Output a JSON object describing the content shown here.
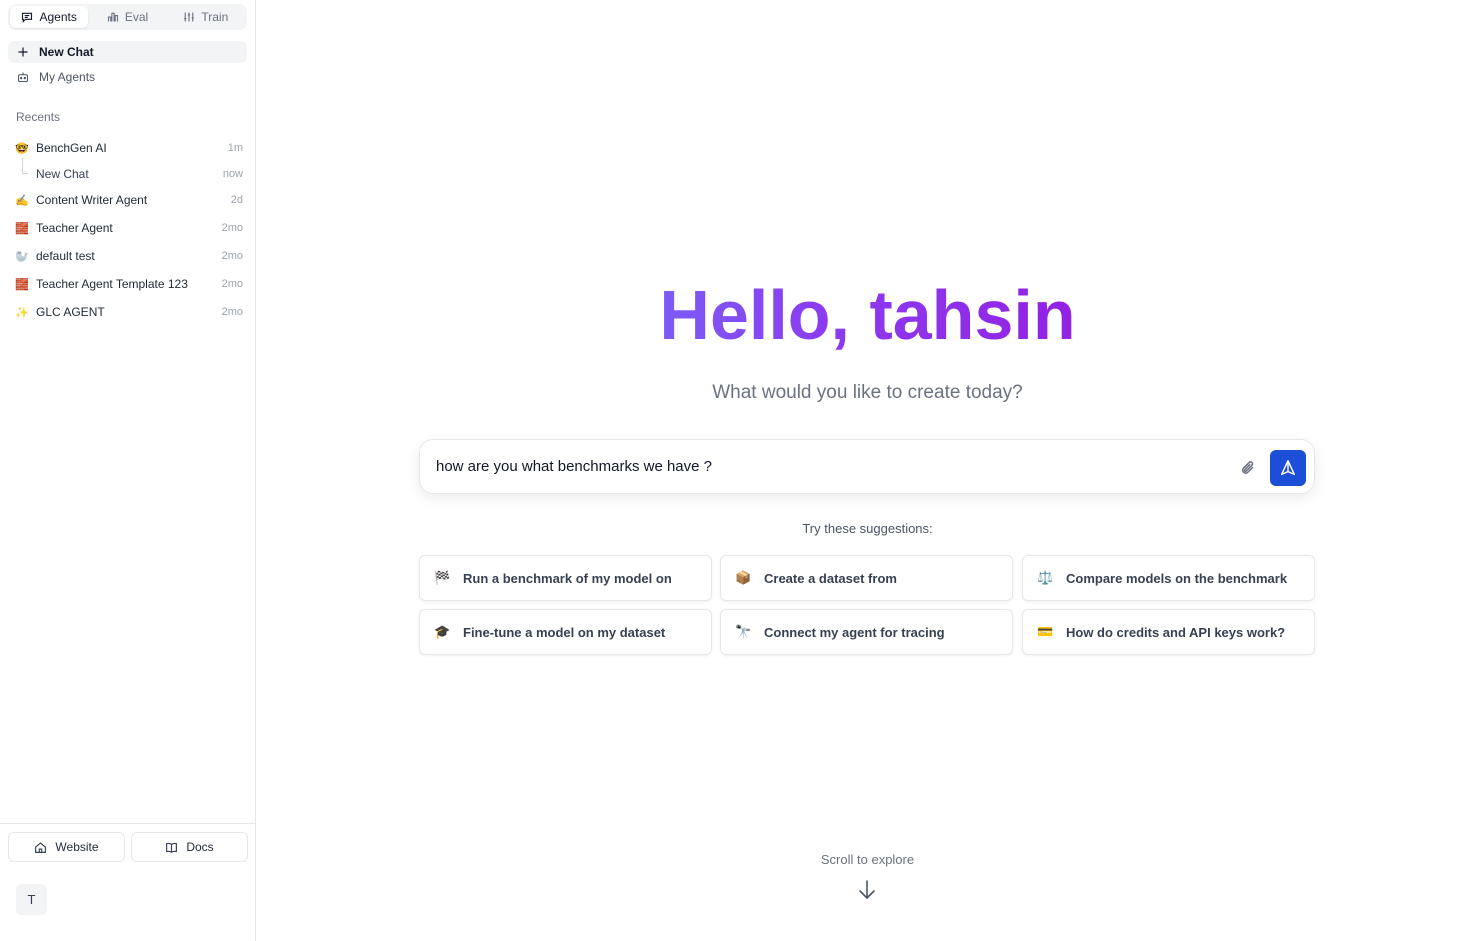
{
  "tabs": [
    {
      "label": "Agents",
      "icon": "chat-icon",
      "active": true
    },
    {
      "label": "Eval",
      "icon": "chart-icon",
      "active": false
    },
    {
      "label": "Train",
      "icon": "sliders-icon",
      "active": false
    }
  ],
  "nav": {
    "new_chat": "New Chat",
    "my_agents": "My Agents"
  },
  "recents": {
    "title": "Recents",
    "items": [
      {
        "emoji": "🤓",
        "label": "BenchGen AI",
        "time": "1m"
      },
      {
        "emoji": "",
        "label": "New Chat",
        "time": "now"
      },
      {
        "emoji": "✍️",
        "label": "Content Writer Agent",
        "time": "2d"
      },
      {
        "emoji": "🧱",
        "label": "Teacher Agent",
        "time": "2mo"
      },
      {
        "emoji": "🦭",
        "label": "default test",
        "time": "2mo"
      },
      {
        "emoji": "🧱",
        "label": "Teacher Agent Template 123",
        "time": "2mo"
      },
      {
        "emoji": "✨",
        "label": "GLC AGENT",
        "time": "2mo"
      }
    ]
  },
  "footer": {
    "website": "Website",
    "docs": "Docs",
    "avatar_initial": "T"
  },
  "main": {
    "greeting": "Hello, tahsin",
    "subtitle": "What would you like to create today?",
    "input_value": "how are you what benchmarks we have ?",
    "suggestions_title": "Try these suggestions:",
    "suggestions": [
      {
        "emoji": "🏁",
        "label": "Run a benchmark of my model on"
      },
      {
        "emoji": "📦",
        "label": "Create a dataset from"
      },
      {
        "emoji": "⚖️",
        "label": "Compare models on the benchmark"
      },
      {
        "emoji": "🎓",
        "label": "Fine-tune a model on my dataset"
      },
      {
        "emoji": "🔭",
        "label": "Connect my agent for tracing"
      },
      {
        "emoji": "💳",
        "label": "How do credits and API keys work?"
      }
    ],
    "scroll_label": "Scroll to explore"
  },
  "colors": {
    "accent": "#1d4ed8",
    "gradient_start": "#7c5cf6",
    "gradient_end": "#9321e3"
  }
}
